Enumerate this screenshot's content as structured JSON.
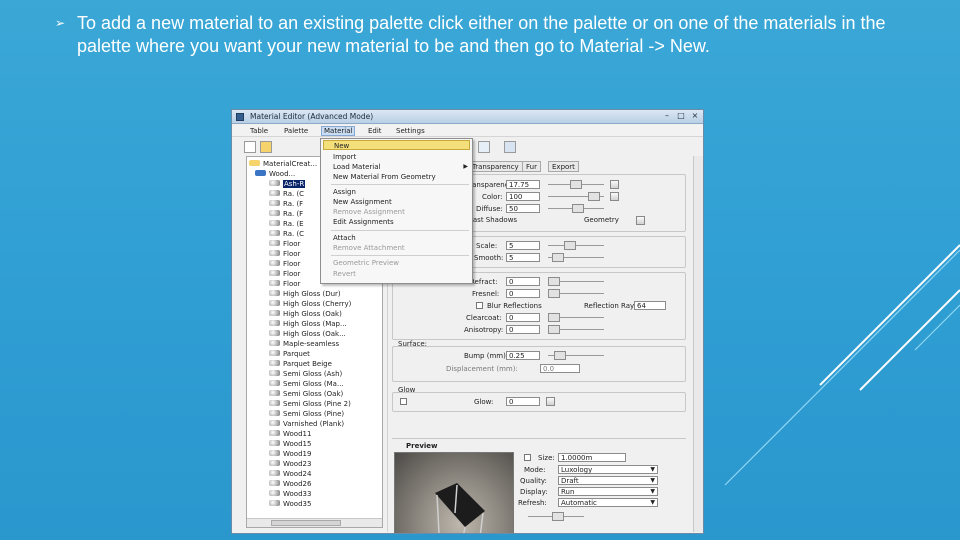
{
  "slide": {
    "bullet_icon": "circled-arrow-bullet",
    "text": "To add a new material to an existing palette click either on the palette or on one of the materials in the palette where you want your new material to be and then go to Material -> New."
  },
  "window": {
    "title": "Material Editor (Advanced Mode)",
    "controls": [
      "–",
      "□",
      "×"
    ],
    "menu": [
      "Table",
      "Palette",
      "Material",
      "Edit",
      "Settings"
    ],
    "active_menu": "Material"
  },
  "popup_menu": {
    "items": [
      {
        "label": "New",
        "state": "highlighted"
      },
      {
        "label": "Import",
        "state": "normal"
      },
      {
        "label": "Load Material",
        "state": "normal",
        "submenu": true
      },
      {
        "label": "New Material From Geometry",
        "state": "normal"
      },
      {
        "label": "Assign",
        "state": "normal"
      },
      {
        "label": "New Assignment",
        "state": "normal"
      },
      {
        "label": "Remove Assignment",
        "state": "disabled"
      },
      {
        "label": "Edit Assignments",
        "state": "normal"
      },
      {
        "label": "Attach",
        "state": "normal"
      },
      {
        "label": "Remove Attachment",
        "state": "disabled"
      },
      {
        "label": "Geometric Preview",
        "state": "disabled"
      },
      {
        "label": "Revert",
        "state": "disabled"
      }
    ]
  },
  "tree": {
    "items": [
      {
        "label": "MaterialCreat...",
        "level": 0
      },
      {
        "label": "Wood...",
        "level": 1
      },
      {
        "label": "Ash-R",
        "level": 2,
        "selected": true
      },
      {
        "label": "Ra. (C",
        "level": 2
      },
      {
        "label": "Ra. (F",
        "level": 2
      },
      {
        "label": "Ra. (F",
        "level": 2
      },
      {
        "label": "Ra. (E",
        "level": 2
      },
      {
        "label": "Ra. (C",
        "level": 2
      },
      {
        "label": "Floor",
        "level": 2
      },
      {
        "label": "Floor",
        "level": 2
      },
      {
        "label": "Floor",
        "level": 2
      },
      {
        "label": "Floor",
        "level": 2
      },
      {
        "label": "Floor",
        "level": 2
      },
      {
        "label": "High Gloss (Dur)",
        "level": 2
      },
      {
        "label": "High Gloss (Cherry)",
        "level": 2
      },
      {
        "label": "High Gloss (Oak)",
        "level": 2
      },
      {
        "label": "High Gloss (Map...",
        "level": 2
      },
      {
        "label": "High Gloss (Oak...",
        "level": 2
      },
      {
        "label": "Maple-seamless",
        "level": 2
      },
      {
        "label": "Parquet",
        "level": 2
      },
      {
        "label": "Parquet Beige",
        "level": 2
      },
      {
        "label": "Semi Gloss (Ash)",
        "level": 2
      },
      {
        "label": "Semi Gloss (Ma...",
        "level": 2
      },
      {
        "label": "Semi Gloss (Oak)",
        "level": 2
      },
      {
        "label": "Semi Gloss (Pine 2)",
        "level": 2
      },
      {
        "label": "Semi Gloss (Pine)",
        "level": 2
      },
      {
        "label": "Varnished (Plank)",
        "level": 2
      },
      {
        "label": "Wood11",
        "level": 2
      },
      {
        "label": "Wood15",
        "level": 2
      },
      {
        "label": "Wood19",
        "level": 2
      },
      {
        "label": "Wood23",
        "level": 2
      },
      {
        "label": "Wood24",
        "level": 2
      },
      {
        "label": "Wood26",
        "level": 2
      },
      {
        "label": "Wood33",
        "level": 2
      },
      {
        "label": "Wood35",
        "level": 2
      }
    ]
  },
  "tabs": [
    "Transparency",
    "Fur",
    "Export"
  ],
  "props": {
    "transparency_lbl": "Transparency:",
    "transparency_val": "17.75",
    "color_lbl": "Color:",
    "color_val": "100",
    "diffuse_lbl": "Diffuse:",
    "diffuse_val": "50",
    "shadows_lbl": "Cast Shadows",
    "geometry_lbl": "Geometry",
    "scale_lbl": "Scale:",
    "scale_val": "5",
    "smooth_lbl": "Smooth:",
    "smooth_val": "5",
    "refract_lbl": "Refract:",
    "refract_val": "0",
    "fresnel_lbl": "Fresnel:",
    "fresnel_val": "0",
    "blur_lbl": "Blur Reflections",
    "rays_lbl": "Reflection Rays:",
    "rays_val": "64",
    "clearcoat_lbl": "Clearcoat:",
    "clearcoat_val": "0",
    "aniso_lbl": "Anisotropy:",
    "aniso_val": "0",
    "surface_lbl": "Surface:",
    "bump_lbl": "Bump (mm):",
    "bump_val": "0.25",
    "displacement_lbl": "Displacement (mm):",
    "displacement_val": "0.0",
    "glow_lbl": "Glow",
    "glow_val_lbl": "Glow:",
    "glow_val": "0",
    "preview_lbl": "Preview",
    "size_lbl": "Size:",
    "size_val": "1.0000m",
    "mode_lbl": "Mode:",
    "mode_val": "Luxology",
    "quality_lbl": "Quality:",
    "quality_val": "Draft",
    "display_lbl": "Display:",
    "display_val": "Run",
    "refresh_lbl": "Refresh:",
    "refresh_val": "Automatic"
  },
  "colors": {
    "background": "#2f9ed3",
    "highlight": "#f3e07a",
    "selection": "#0a246a"
  }
}
